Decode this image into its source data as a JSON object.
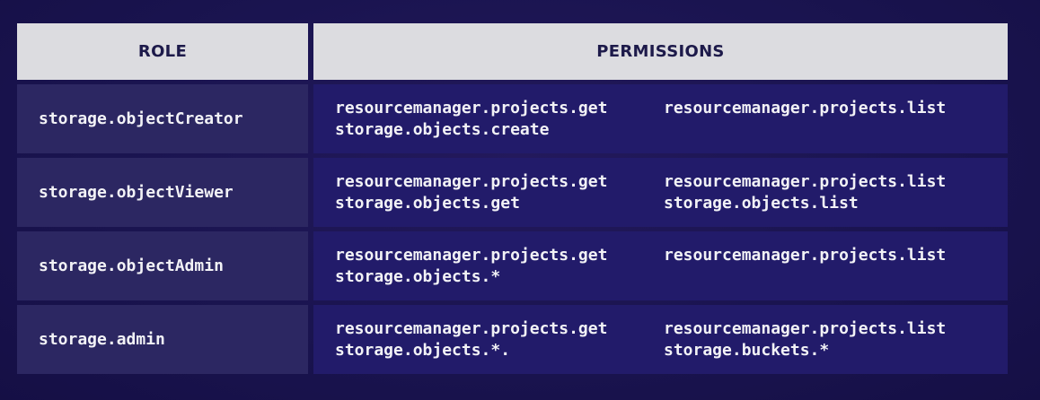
{
  "header": {
    "role": "ROLE",
    "permissions": "PERMISSIONS"
  },
  "rows": [
    {
      "role": "storage.objectCreator",
      "perms": [
        "resourcemanager.projects.get",
        "resourcemanager.projects.list",
        "storage.objects.create",
        ""
      ]
    },
    {
      "role": "storage.objectViewer",
      "perms": [
        "resourcemanager.projects.get",
        "resourcemanager.projects.list",
        "storage.objects.get",
        "storage.objects.list"
      ]
    },
    {
      "role": "storage.objectAdmin",
      "perms": [
        "resourcemanager.projects.get",
        "resourcemanager.projects.list",
        "storage.objects.*",
        ""
      ]
    },
    {
      "role": "storage.admin",
      "perms": [
        "resourcemanager.projects.get",
        "resourcemanager.projects.list",
        "storage.objects.*.",
        "storage.buckets.*"
      ]
    }
  ]
}
